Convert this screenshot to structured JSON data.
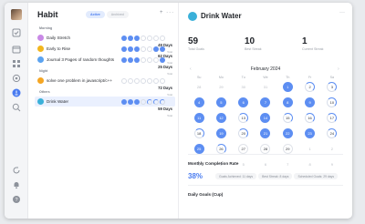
{
  "app": {
    "title": "Habit"
  },
  "filters": {
    "active": "Active",
    "archived": "Archived"
  },
  "list_tools": "+ ···",
  "groups": {
    "morning": "Morning",
    "night": "Night",
    "others": "Others"
  },
  "habits": [
    {
      "name": "Daily Stretch",
      "days": "49 Days",
      "sub": "Total",
      "color": "#c989e6"
    },
    {
      "name": "Early to Rise",
      "days": "62 Days",
      "sub": "Total",
      "color": "#f2b61e"
    },
    {
      "name": "Journal 3 Pages of random thoughts",
      "days": "25 Days",
      "sub": "Total",
      "color": "#5ba3f0"
    },
    {
      "name": "solve one problem in javascript/c++",
      "days": "72 Days",
      "sub": "Total",
      "color": "#f5a623"
    },
    {
      "name": "Drink Water",
      "days": "59 Days",
      "sub": "Total",
      "color": "#3ab0d9"
    }
  ],
  "detail": {
    "title": "Drink Water",
    "more": "···",
    "stats": [
      {
        "value": "59",
        "label": "Total Goals"
      },
      {
        "value": "10",
        "label": "Best Streak"
      },
      {
        "value": "1",
        "label": "Current Streak"
      }
    ],
    "calendar": {
      "month": "February 2024",
      "prev": "‹",
      "next": "›",
      "weekdays": [
        "Su",
        "Mo",
        "Tu",
        "We",
        "Th",
        "Fr",
        "Sa"
      ]
    },
    "completion": {
      "title": "Monthly Completion Rate",
      "rate": "38%",
      "chips": [
        "Goals Achieved: 11 days",
        "Best Streak: 8 days",
        "Scheduled Goals: 29 days"
      ]
    },
    "daily_goals_title": "Daily Goals (Cup)"
  }
}
